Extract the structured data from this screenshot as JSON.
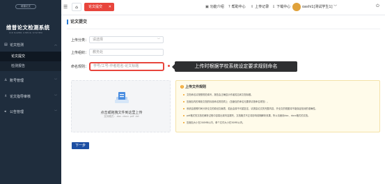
{
  "sidebar": {
    "badge": "维普论文",
    "title": "维普论文检测系统",
    "subtitle": "VIP PAPER CHECK SYSTEM",
    "groups": [
      {
        "icon": "document-icon",
        "label": "论文检测"
      },
      {
        "icon": "user-icon",
        "label": "账号管理"
      },
      {
        "icon": "graduation-cap-icon",
        "label": "论文指导审核"
      },
      {
        "icon": "megaphone-icon",
        "label": "公告管理"
      }
    ],
    "sub_items": [
      {
        "label": "论文提交"
      },
      {
        "label": "检测报告"
      }
    ]
  },
  "topbar": {
    "tab_label": "论文提交",
    "items": [
      {
        "icon": "book-icon",
        "label": "功能介绍"
      },
      {
        "icon": "help-icon",
        "label": "帮助中心"
      },
      {
        "icon": "upload-icon",
        "label": "上传记录"
      },
      {
        "icon": "download-icon",
        "label": "下载中心"
      }
    ],
    "user": "oashi1[测试学生1]"
  },
  "page": {
    "title": "论文提交",
    "category_label": "上传分类：",
    "category_placeholder": "请选择",
    "org_label": "上传组织：",
    "org_value": "教务处",
    "name_label": "命名规则：",
    "name_value": "学号/工号-作者姓名-论文标题",
    "tooltip": "上传时根据学校系统设定要求规则命名"
  },
  "upload": {
    "text": "点击或拖拽文件到这里上传",
    "hint": "支持格式：.doc .docx .pdf .txt"
  },
  "rules": {
    "title": "上传文件规则",
    "items": [
      "文档命名请按照规范填写，报告会正确显示作者姓名和文档标题。",
      "压缩包内的单篇文档的标准命名规范同上（压缩包的命名无要求请按命名规范）。",
      "系统会按照时间分析论文的原创文献表，若此由原不可重复定，请提高论文的完整内容，开全文的视图将不能保证检测的准确性。",
      "pdf格式的文档在解析过程中容易出现内容漏失，文档格式不正将影响前期解析效果，所以请使用doc、docx格式的文档。",
      "压缩包大小在200MB以内，单个文件大小在30MB以内。"
    ]
  },
  "next_button": "下一步"
}
